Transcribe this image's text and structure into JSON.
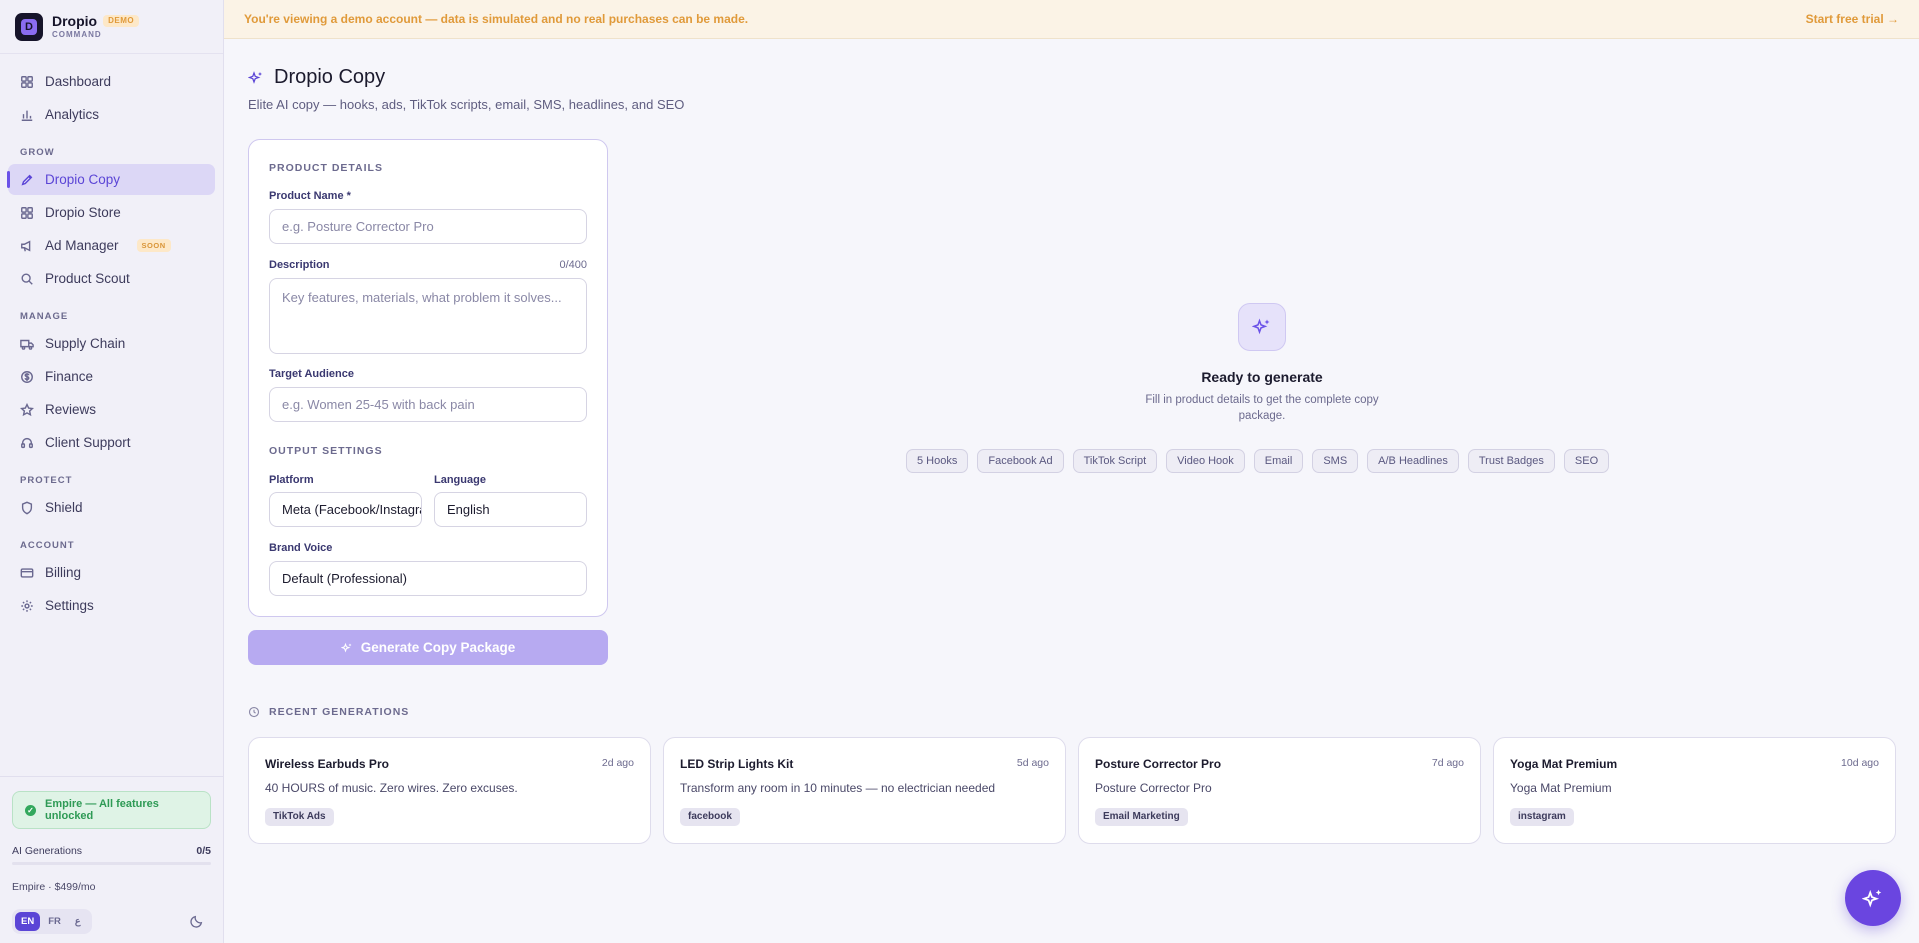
{
  "brand": {
    "name": "Dropio",
    "badge": "DEMO",
    "sub": "COMMAND",
    "logo_letter": "D"
  },
  "nav": {
    "dashboard": "Dashboard",
    "analytics": "Analytics",
    "section_grow": "GROW",
    "dropio_copy": "Dropio Copy",
    "dropio_store": "Dropio Store",
    "ad_manager": "Ad Manager",
    "soon_badge": "SOON",
    "product_scout": "Product Scout",
    "section_manage": "MANAGE",
    "supply_chain": "Supply Chain",
    "finance": "Finance",
    "reviews": "Reviews",
    "client_support": "Client Support",
    "section_protect": "PROTECT",
    "shield": "Shield",
    "section_account": "ACCOUNT",
    "billing": "Billing",
    "settings": "Settings"
  },
  "sidebar_bottom": {
    "plan_status": "Empire — All features unlocked",
    "generations_label": "AI Generations",
    "generations_count": "0/5",
    "generations_used": 0,
    "plan_price": "Empire · $499/mo",
    "languages": [
      "EN",
      "FR",
      "ع"
    ],
    "active_language": "EN"
  },
  "banner": {
    "message": "You're viewing a demo account — data is simulated and no real purchases can be made.",
    "cta": "Start free trial →"
  },
  "page": {
    "title": "Dropio Copy",
    "subtitle": "Elite AI copy — hooks, ads, TikTok scripts, email, SMS, headlines, and SEO"
  },
  "form": {
    "section_product": "PRODUCT DETAILS",
    "product_name_label": "Product Name *",
    "product_name_placeholder": "e.g. Posture Corrector Pro",
    "description_label": "Description",
    "description_count": "0/400",
    "description_placeholder": "Key features, materials, what problem it solves...",
    "audience_label": "Target Audience",
    "audience_placeholder": "e.g. Women 25-45 with back pain",
    "section_output": "OUTPUT SETTINGS",
    "platform_label": "Platform",
    "platform_value": "Meta (Facebook/Instagram)",
    "language_label": "Language",
    "language_value": "English",
    "voice_label": "Brand Voice",
    "voice_value": "Default (Professional)",
    "generate_button": "Generate Copy Package"
  },
  "empty_state": {
    "title": "Ready to generate",
    "description": "Fill in product details to get the complete copy package.",
    "chips": [
      "5 Hooks",
      "Facebook Ad",
      "TikTok Script",
      "Video Hook",
      "Email",
      "SMS",
      "A/B Headlines",
      "Trust Badges",
      "SEO"
    ]
  },
  "recent": {
    "heading": "RECENT GENERATIONS",
    "items": [
      {
        "title": "Wireless Earbuds Pro",
        "time": "2d ago",
        "text": "40 HOURS of music. Zero wires. Zero excuses.",
        "tag": "TikTok Ads"
      },
      {
        "title": "LED Strip Lights Kit",
        "time": "5d ago",
        "text": "Transform any room in 10 minutes — no electrician needed",
        "tag": "facebook"
      },
      {
        "title": "Posture Corrector Pro",
        "time": "7d ago",
        "text": "Posture Corrector Pro",
        "tag": "Email Marketing"
      },
      {
        "title": "Yoga Mat Premium",
        "time": "10d ago",
        "text": "Yoga Mat Premium",
        "tag": "instagram"
      }
    ]
  },
  "colors": {
    "accent": "#6b52e8",
    "banner_text": "#e09a3a",
    "success": "#33a85d"
  }
}
